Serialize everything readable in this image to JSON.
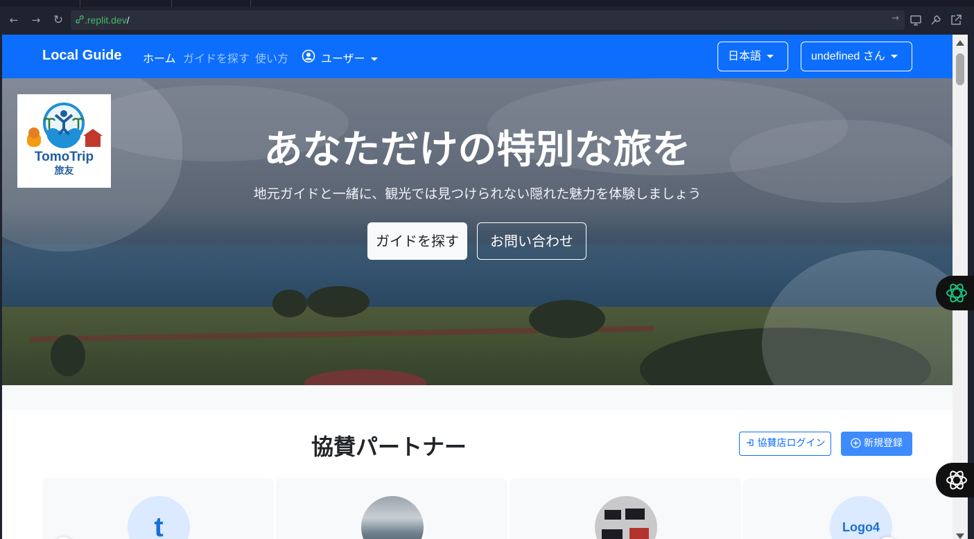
{
  "browser": {
    "url_host": ".replit.dev",
    "url_path": "/",
    "back_icon": "←",
    "forward_icon": "→",
    "reload_icon": "↻",
    "go_icon": "→"
  },
  "navbar": {
    "brand": "Local Guide",
    "links": [
      {
        "label": "ホーム",
        "active": true
      },
      {
        "label": "ガイドを探す",
        "active": false
      },
      {
        "label": "使い方",
        "active": false
      }
    ],
    "user_menu_label": "ユーザー",
    "language_button": "日本語",
    "account_button": "undefined さん",
    "accent_color": "#0d6efd"
  },
  "hero": {
    "logo_text_top": "TomoTrip",
    "logo_text_bottom": "旅友",
    "title": "あなただけの特別な旅を",
    "subtitle": "地元ガイドと一緒に、観光では見つけられない隠れた魅力を体験しましょう",
    "primary_button": "ガイドを探す",
    "secondary_button": "お問い合わせ"
  },
  "sponsors": {
    "title": "協賛パートナー",
    "login_button": "協賛店ログイン",
    "register_button": "新規登録",
    "cards": [
      {
        "avatar_text": "t",
        "avatar_type": "letter"
      },
      {
        "avatar_text": "",
        "avatar_type": "photo-sea"
      },
      {
        "avatar_text": "",
        "avatar_type": "photo-food"
      },
      {
        "avatar_text": "Logo4",
        "avatar_type": "text"
      }
    ]
  }
}
